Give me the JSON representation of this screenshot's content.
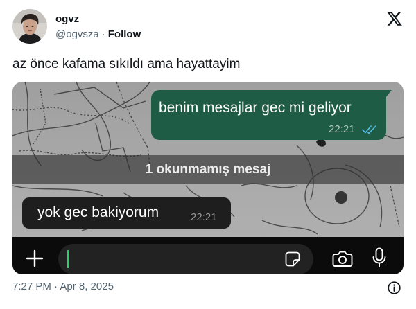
{
  "tweet": {
    "author": {
      "display_name": "ogvz",
      "handle": "@ogvsza",
      "separator": "·",
      "follow_label": "Follow"
    },
    "text": "az önce kafama sıkıldı ama hayattayim",
    "timestamp": "7:27 PM · Apr 8, 2025"
  },
  "media": {
    "chat": {
      "outgoing_message": {
        "text": "benim mesajlar gec mi geliyor",
        "time": "22:21",
        "status_icon": "double-check-read-icon"
      },
      "unread_divider": "1 okunmamış mesaj",
      "incoming_message": {
        "text": "yok gec bakiyorum",
        "time": "22:21"
      },
      "composer": {
        "value": "",
        "icons": [
          "plus-icon",
          "sticker-icon",
          "camera-icon",
          "mic-icon"
        ]
      }
    }
  },
  "icons": {
    "brand": "x-logo-icon",
    "footer": "info-icon"
  },
  "colors": {
    "text_primary": "#0f1419",
    "text_secondary": "#536471",
    "bubble_outgoing": "#1f5c46",
    "bubble_incoming": "#1e1e1e",
    "read_ticks": "#53bdeb",
    "cursor": "#25d366",
    "composer_bar": "#0b0b0b",
    "composer_field": "#222222"
  }
}
